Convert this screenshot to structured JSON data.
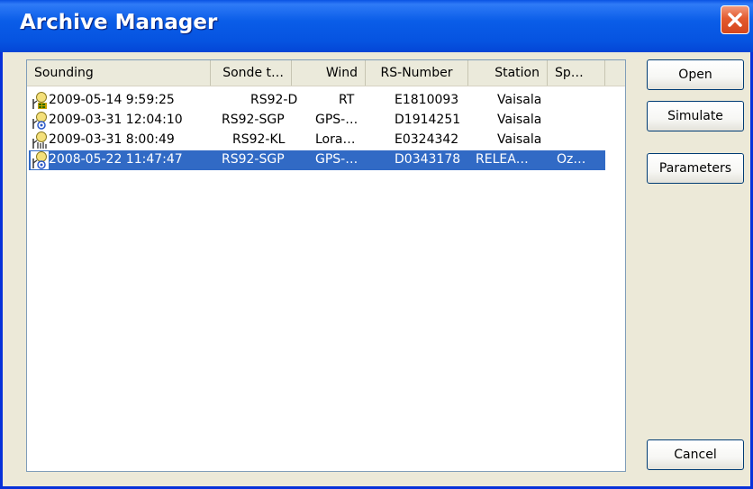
{
  "window": {
    "title": "Archive Manager"
  },
  "colors": {
    "titlebar": "#0a5de8",
    "selection": "#316ac5",
    "close_button": "#e35a2e"
  },
  "table": {
    "columns": [
      "Sounding",
      "Sonde t…",
      "Wind",
      "RS-Number",
      "Station",
      "Sp…"
    ],
    "rows": [
      {
        "icon": "radiosonde-icon",
        "sounding": "2009-05-14  9:59:25",
        "sonde": "RS92-D",
        "wind": "RT",
        "rs_number": "E1810093",
        "station": "Vaisala",
        "sp": "",
        "selected": false
      },
      {
        "icon": "radiosonde-gps-icon",
        "sounding": "2009-03-31 12:04:10",
        "sonde": "RS92-SGP",
        "wind": "GPS-…",
        "rs_number": "D1914251",
        "station": "Vaisala",
        "sp": "",
        "selected": false
      },
      {
        "icon": "radiosonde-loran-icon",
        "sounding": "2009-03-31  8:00:49",
        "sonde": "RS92-KL",
        "wind": "Lora…",
        "rs_number": "E0324342",
        "station": "Vaisala",
        "sp": "",
        "selected": false
      },
      {
        "icon": "radiosonde-gps-icon",
        "sounding": "2008-05-22 11:47:47",
        "sonde": "RS92-SGP",
        "wind": "GPS-…",
        "rs_number": "D0343178",
        "station": "RELEA…",
        "sp": "Oz…",
        "selected": true
      }
    ]
  },
  "buttons": {
    "open": "Open",
    "simulate": "Simulate",
    "parameters": "Parameters",
    "cancel": "Cancel"
  }
}
